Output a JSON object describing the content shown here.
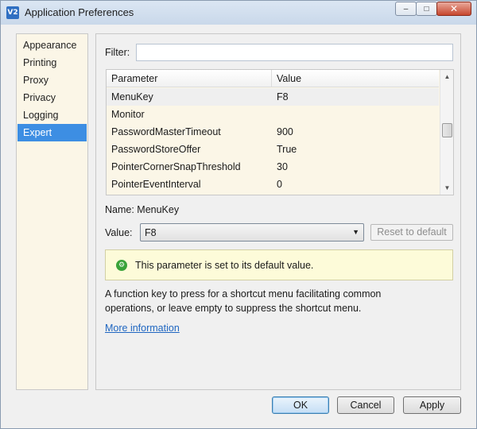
{
  "window": {
    "title": "Application Preferences",
    "icon_text": "V2"
  },
  "caption_buttons": {
    "minimize": "‒",
    "maximize": "□",
    "close": "✕"
  },
  "sidebar": {
    "items": [
      {
        "label": "Appearance",
        "selected": false
      },
      {
        "label": "Printing",
        "selected": false
      },
      {
        "label": "Proxy",
        "selected": false
      },
      {
        "label": "Privacy",
        "selected": false
      },
      {
        "label": "Logging",
        "selected": false
      },
      {
        "label": "Expert",
        "selected": true
      }
    ]
  },
  "filter": {
    "label": "Filter:",
    "value": "",
    "placeholder": ""
  },
  "table": {
    "columns": [
      "Parameter",
      "Value"
    ],
    "rows": [
      {
        "name": "MenuKey",
        "value": "F8",
        "selected": true
      },
      {
        "name": "Monitor",
        "value": "",
        "selected": false
      },
      {
        "name": "PasswordMasterTimeout",
        "value": "900",
        "selected": false
      },
      {
        "name": "PasswordStoreOffer",
        "value": "True",
        "selected": false
      },
      {
        "name": "PointerCornerSnapThreshold",
        "value": "30",
        "selected": false
      },
      {
        "name": "PointerEventInterval",
        "value": "0",
        "selected": false
      }
    ]
  },
  "details": {
    "name_line": "Name: MenuKey",
    "value_label": "Value:",
    "value_selected": "F8",
    "reset_label": "Reset to default",
    "notice_text": "This parameter is set to its default value.",
    "description_line1": "A function key to press for a shortcut menu facilitating common",
    "description_line2": "operations, or leave empty to suppress the shortcut menu.",
    "more_link": "More information"
  },
  "buttons": {
    "ok": "OK",
    "cancel": "Cancel",
    "apply": "Apply"
  },
  "colors": {
    "selection": "#3d8ee3",
    "list_background": "#fbf6e7",
    "notice_background": "#fdfbd9",
    "link": "#1f66c1",
    "success_icon": "#3aa33a"
  }
}
